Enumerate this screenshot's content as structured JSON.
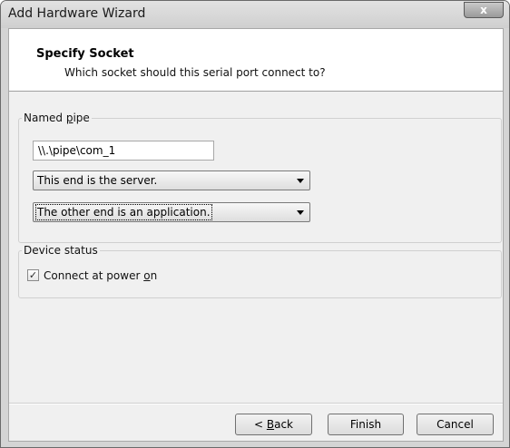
{
  "window": {
    "title": "Add Hardware Wizard",
    "close_glyph": "x"
  },
  "header": {
    "title": "Specify Socket",
    "subtitle": "Which socket should this serial port connect to?"
  },
  "named_pipe": {
    "label_pre": "Named ",
    "label_key": "p",
    "label_post": "ipe",
    "path_value": "\\\\.\\pipe\\com_1",
    "end_selected": "This end is the server.",
    "other_selected": "The other end is an application."
  },
  "device_status": {
    "label": "Device status",
    "checkbox_checked": true,
    "checkbox_mark": "✓",
    "connect_pre": "Connect at power ",
    "connect_key": "o",
    "connect_post": "n"
  },
  "buttons": {
    "back_pre": "< ",
    "back_key": "B",
    "back_post": "ack",
    "finish": "Finish",
    "cancel": "Cancel"
  }
}
